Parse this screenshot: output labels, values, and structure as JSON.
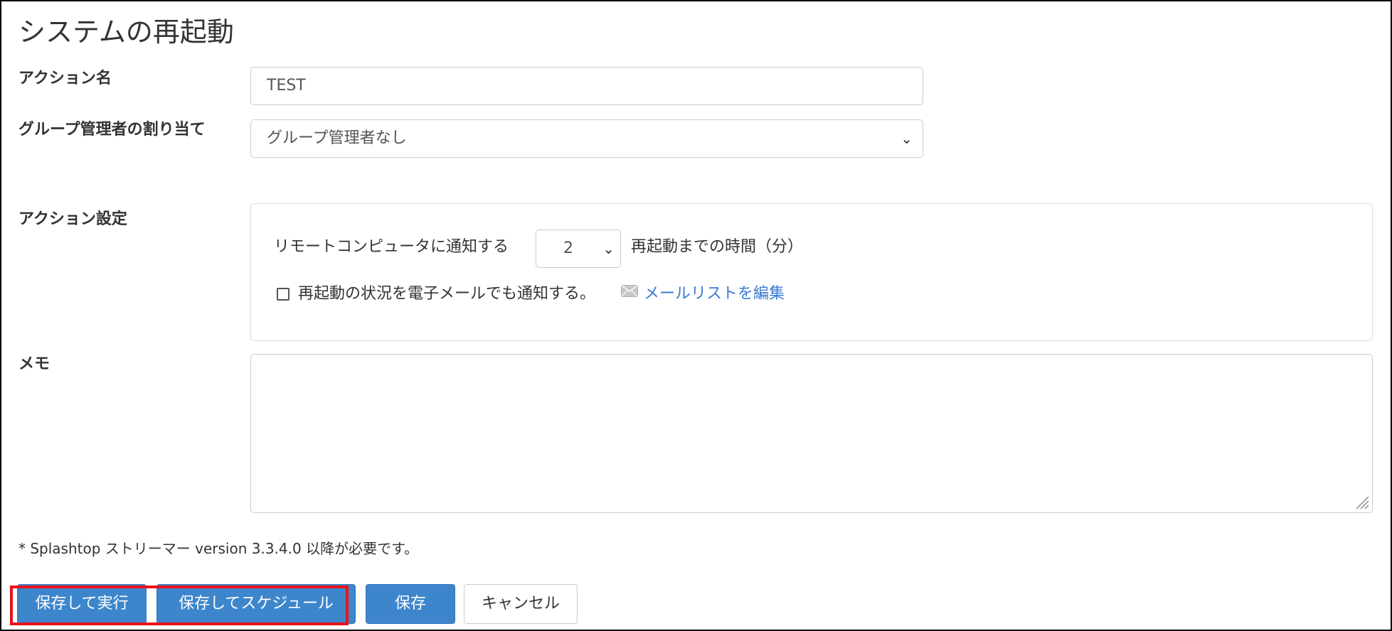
{
  "page": {
    "title": "システムの再起動"
  },
  "form": {
    "action_name": {
      "label": "アクション名",
      "value": "TEST"
    },
    "group_admin": {
      "label": "グループ管理者の割り当て",
      "selected": "グループ管理者なし"
    },
    "action_settings": {
      "label": "アクション設定",
      "notify_label": "リモートコンピュータに通知する",
      "notify_minutes": "2",
      "restart_time_label": "再起動までの時間（分）",
      "email_checkbox_label": "再起動の状況を電子メールでも通知する。",
      "email_checked": false,
      "edit_mail_list_link": "メールリストを編集",
      "mail_icon": "envelope-icon"
    },
    "memo": {
      "label": "メモ",
      "value": ""
    }
  },
  "footnote": "* Splashtop ストリーマー version 3.3.4.0 以降が必要です。",
  "buttons": {
    "save_and_run": "保存して実行",
    "save_and_schedule": "保存してスケジュール",
    "save": "保存",
    "cancel": "キャンセル"
  },
  "colors": {
    "primary": "#3d86cc",
    "link": "#3a7bd5",
    "highlight": "#e8131b"
  }
}
